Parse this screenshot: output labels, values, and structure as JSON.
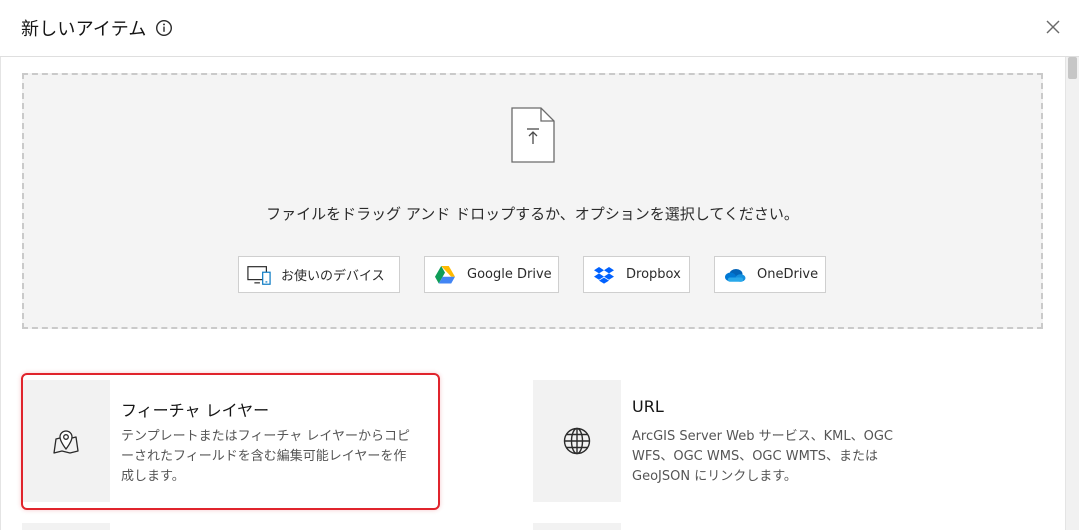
{
  "dialog": {
    "title": "新しいアイテム",
    "info_icon": "info-icon",
    "close_icon": "close-icon"
  },
  "dropzone": {
    "file_icon": "file-upload-icon",
    "instruction": "ファイルをドラッグ アンド ドロップするか、オプションを選択してください。",
    "sources": [
      {
        "label": "お使いのデバイス",
        "icon": "device-icon"
      },
      {
        "label": "Google Drive",
        "icon": "google-drive-icon"
      },
      {
        "label": "Dropbox",
        "icon": "dropbox-icon"
      },
      {
        "label": "OneDrive",
        "icon": "onedrive-icon"
      }
    ]
  },
  "options": [
    {
      "title": "フィーチャ レイヤー",
      "description": "テンプレートまたはフィーチャ レイヤーからコピーされたフィールドを含む編集可能レイヤーを作成します。",
      "icon": "map-pin-icon",
      "highlighted": true
    },
    {
      "title": "URL",
      "description": "ArcGIS Server Web サービス、KML、OGC WFS、OGC WMS、OGC WMTS、または GeoJSON にリンクします。",
      "icon": "globe-icon",
      "highlighted": false
    }
  ],
  "colors": {
    "highlight": "#e0242c",
    "dropzone_bg": "#f4f4f4",
    "card_thumb_bg": "#f2f2f2"
  }
}
